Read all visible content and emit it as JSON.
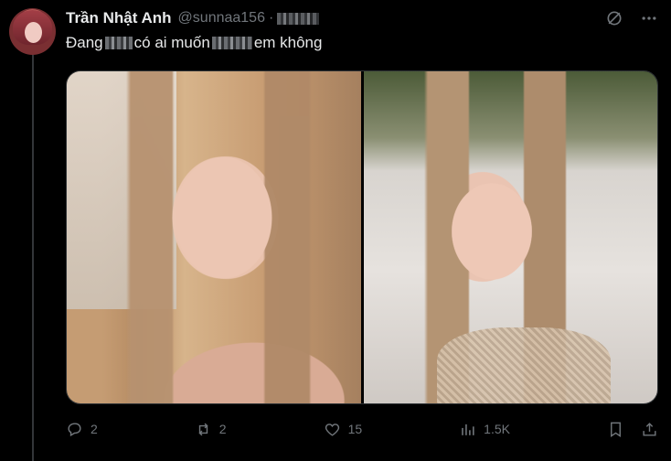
{
  "tweet": {
    "display_name": "Trần Nhật Anh",
    "handle": "@sunnaa156",
    "separator": "·",
    "text_part1": "Đang ",
    "text_part2": "có ai muốn",
    "text_part3": "em không"
  },
  "actions": {
    "replies": "2",
    "reposts": "2",
    "likes": "15",
    "views": "1.5K"
  },
  "icons": {
    "grok": "grok-icon",
    "more": "more-icon",
    "reply": "reply-icon",
    "repost": "repost-icon",
    "like": "heart-icon",
    "views": "views-icon",
    "bookmark": "bookmark-icon",
    "share": "share-icon"
  },
  "colors": {
    "background": "#000000",
    "text": "#e7e9ea",
    "muted": "#71767b",
    "border": "#2f3336"
  }
}
